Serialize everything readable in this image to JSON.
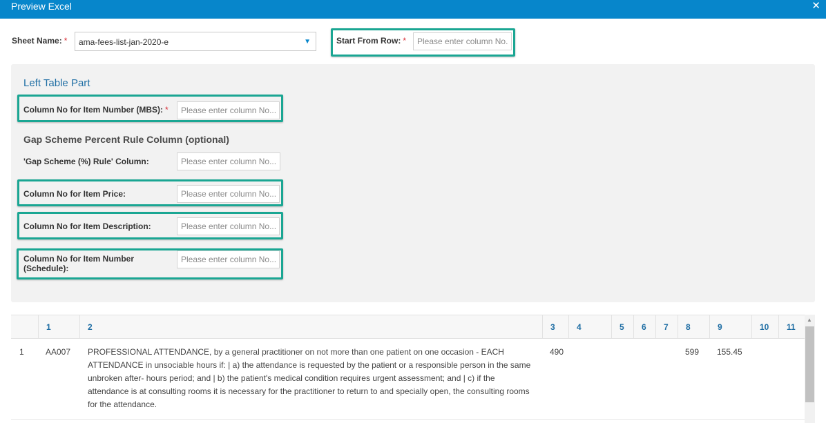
{
  "dialog": {
    "title": "Preview Excel",
    "close_glyph": "✕"
  },
  "sheet": {
    "label": "Sheet Name:",
    "required_mark": "*",
    "selected": "ama-fees-list-jan-2020-e",
    "caret_glyph": "▼"
  },
  "start_row": {
    "label": "Start From Row:",
    "required_mark": "*",
    "placeholder": "Please enter column No..."
  },
  "left_panel": {
    "title": "Left Table Part",
    "item_number_mbs": {
      "label": "Column No for Item Number (MBS):",
      "required_mark": "*",
      "placeholder": "Please enter column No..."
    },
    "gap_section_title": "Gap Scheme Percent Rule Column (optional)",
    "gap_rule": {
      "label": "'Gap Scheme (%) Rule' Column:",
      "placeholder": "Please enter column No..."
    },
    "item_price": {
      "label": "Column No for Item Price:",
      "placeholder": "Please enter column No..."
    },
    "item_description": {
      "label": "Column No for Item Description:",
      "placeholder": "Please enter column No..."
    },
    "item_number_schedule": {
      "label_line1": "Column No for Item Number",
      "label_line2": "(Schedule):",
      "placeholder": "Please enter column No..."
    }
  },
  "table": {
    "columns": [
      "",
      "1",
      "2",
      "3",
      "4",
      "5",
      "6",
      "7",
      "8",
      "9",
      "10",
      "11"
    ],
    "rows": [
      {
        "cells": [
          "1",
          "AA007",
          "PROFESSIONAL ATTENDANCE, by a general practitioner on not more than one patient on one occasion - EACH ATTENDANCE in unsociable hours if: | a) the attendance is requested by the patient or a responsible person in the same unbroken after- hours period; and | b) the patient's medical condition requires urgent assessment; and | c) if the attendance is at consulting rooms it is necessary for the practitioner to return to and specially open, the consulting rooms for the attendance.",
          "490",
          "",
          "",
          "",
          "",
          "599",
          "155.45",
          "",
          ""
        ]
      }
    ]
  },
  "colors": {
    "titlebar": "#0786cb",
    "highlight": "#1aa693",
    "panel": "#f2f2f2",
    "link_blue": "#1f6ea4"
  },
  "icons": {
    "close": "close-icon",
    "dropdown": "chevron-down-icon",
    "scroll_up": "arrow-up-icon"
  }
}
